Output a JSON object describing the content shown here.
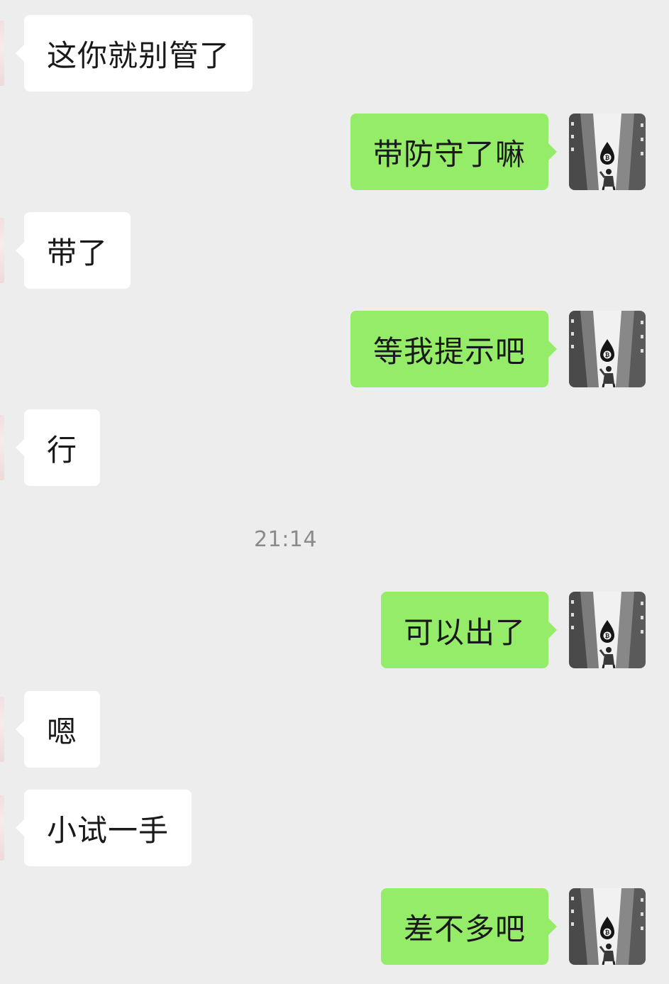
{
  "chat": {
    "messages": [
      {
        "side": "incoming",
        "text": "这你就别管了"
      },
      {
        "side": "outgoing",
        "text": "带防守了嘛"
      },
      {
        "side": "incoming",
        "text": "带了"
      },
      {
        "side": "outgoing",
        "text": "等我提示吧"
      },
      {
        "side": "incoming",
        "text": "行"
      },
      {
        "side": "outgoing",
        "text": "可以出了"
      },
      {
        "side": "incoming",
        "text": "嗯"
      },
      {
        "side": "incoming",
        "text": "小试一手"
      },
      {
        "side": "outgoing",
        "text": "差不多吧"
      }
    ],
    "timestamp": "21:14"
  },
  "colors": {
    "background": "#ededed",
    "incoming_bubble": "#ffffff",
    "outgoing_bubble": "#95ec69",
    "text": "#191919",
    "timestamp_text": "#8a8a8a"
  },
  "avatar": {
    "icon": "user-avatar-bitcoin-street-icon"
  }
}
